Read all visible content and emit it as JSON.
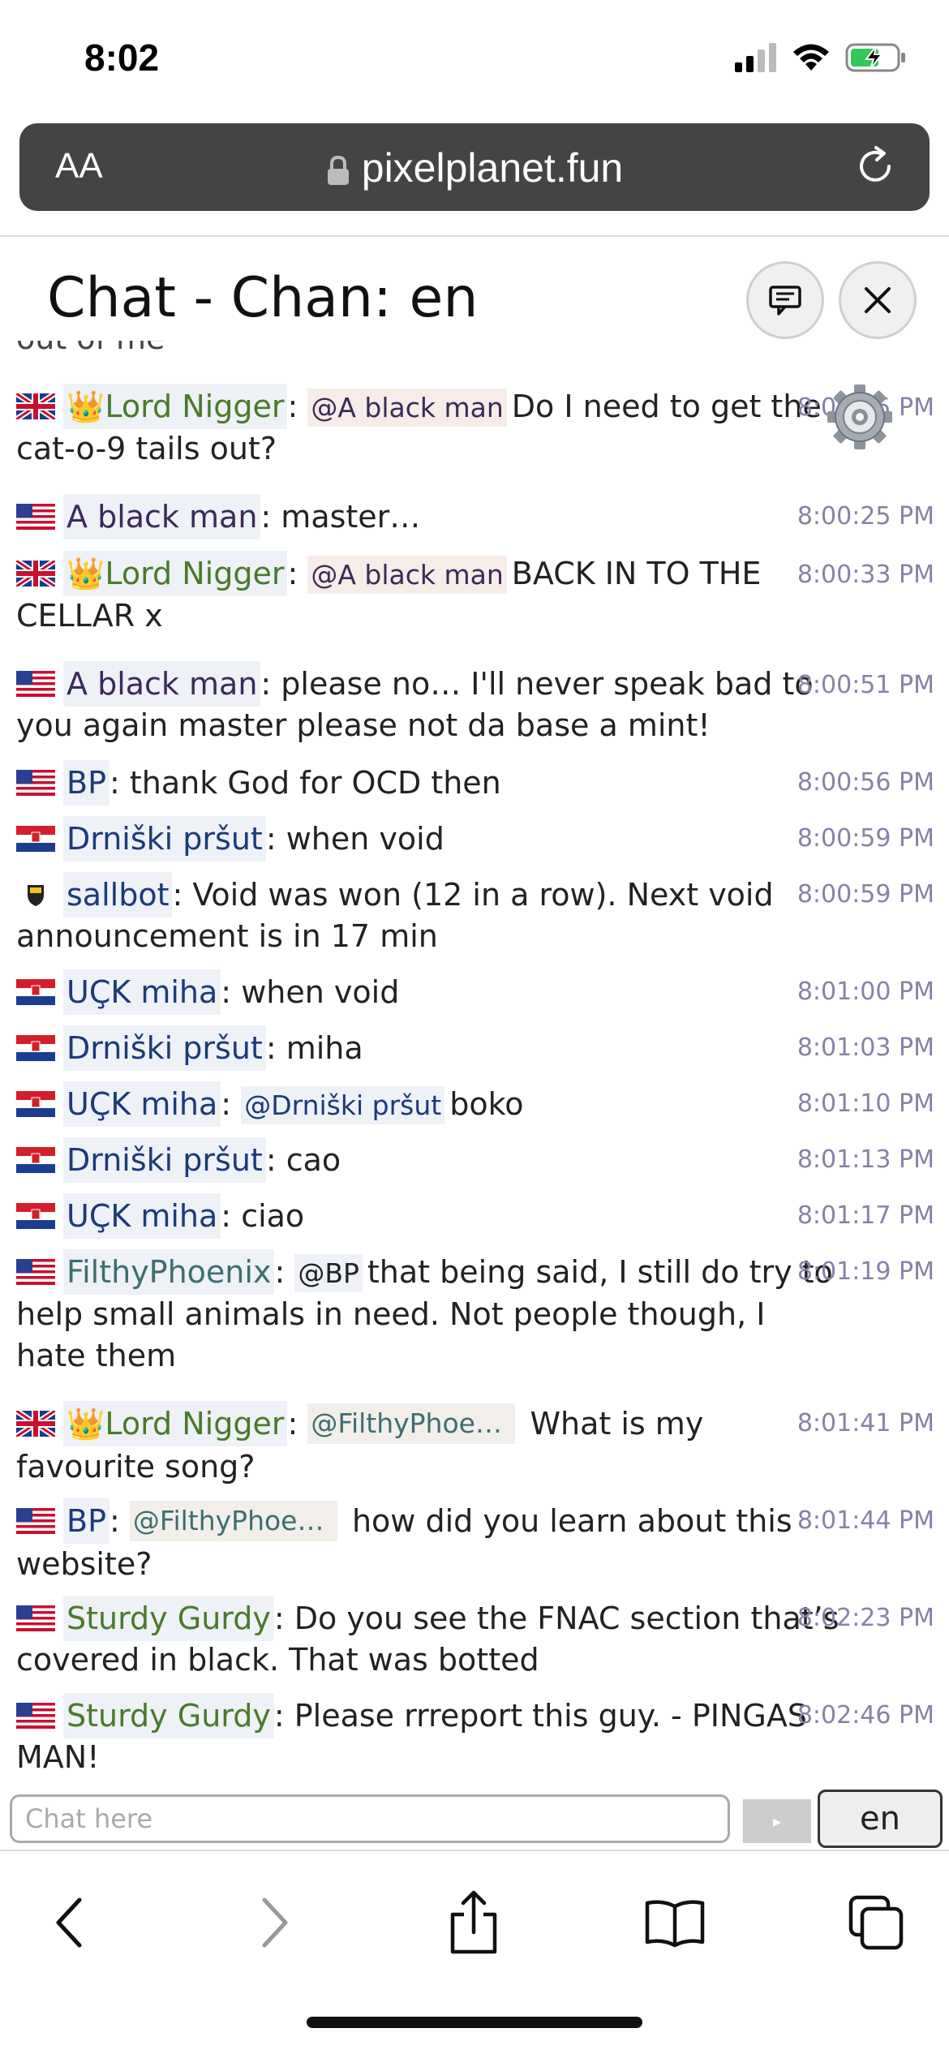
{
  "status_bar": {
    "time": "8:02"
  },
  "browser": {
    "text_size_label": "AA",
    "url": "pixelplanet.fun"
  },
  "chat": {
    "title": "Chat - Chan: en",
    "input_placeholder": "Chat here",
    "send_label": "▸",
    "channel_button_label": "en",
    "messages": [
      {
        "user": "Lord Nigger",
        "crown": "👑",
        "flag": "gb",
        "mention": "@A black man",
        "text": "Do I need to get the cat-o-9 tails out?",
        "time": "8:00:15 PM"
      },
      {
        "user": "A black man",
        "flag": "us",
        "text": "master…",
        "time": "8:00:25 PM"
      },
      {
        "user": "Lord Nigger",
        "crown": "👑",
        "flag": "gb",
        "mention": "@A black man",
        "text": "BACK IN TO THE CELLAR x",
        "time": "8:00:33 PM"
      },
      {
        "user": "A black man",
        "flag": "us",
        "text": "please no… I'll never speak bad to you again master please not da base a mint!",
        "time": "8:00:51 PM"
      },
      {
        "user": "BP",
        "flag": "us",
        "text": "thank God for OCD then",
        "time": "8:00:56 PM"
      },
      {
        "user": "Drniški pršut",
        "flag": "hr",
        "text": "when void",
        "time": "8:00:59 PM"
      },
      {
        "user": "sallbot",
        "flag": "bot",
        "text": "Void was won (12 in a row). Next void announcement is in 17 min",
        "time": "8:00:59 PM"
      },
      {
        "user": "UÇK miha",
        "flag": "hr",
        "text": "when void",
        "time": "8:01:00 PM"
      },
      {
        "user": "Drniški pršut",
        "flag": "hr",
        "text": "miha",
        "time": "8:01:03 PM"
      },
      {
        "user": "UÇK miha",
        "flag": "hr",
        "mention": "@Drniški pršut",
        "text": "boko",
        "time": "8:01:10 PM"
      },
      {
        "user": "Drniški pršut",
        "flag": "hr",
        "text": "cao",
        "time": "8:01:13 PM"
      },
      {
        "user": "UÇK miha",
        "flag": "hr",
        "text": "ciao",
        "time": "8:01:17 PM"
      },
      {
        "user": "FilthyPhoenix",
        "flag": "us",
        "mention": "@BP",
        "text": "that being said, I still do try to help small animals in need. Not people though, I hate them",
        "time": "8:01:19 PM"
      },
      {
        "user": "Lord Nigger",
        "crown": "👑",
        "flag": "gb",
        "mention": "@FilthyPhoenix",
        "text": "What is my favourite song?",
        "time": "8:01:41 PM"
      },
      {
        "user": "BP",
        "flag": "us",
        "mention": "@FilthyPhoenix",
        "text": "how did you learn about this website?",
        "time": "8:01:44 PM"
      },
      {
        "user": "Sturdy Gurdy",
        "flag": "us",
        "text": "Do you see the FNAC section that’s covered in black. That was botted",
        "time": "8:02:23 PM"
      },
      {
        "user": "Sturdy Gurdy",
        "flag": "us",
        "text": "Please rrreport this guy. - PINGAS MAN!",
        "time": "8:02:46 PM"
      }
    ]
  },
  "icons": {
    "signal": "cellular-signal-icon",
    "wifi": "wifi-icon",
    "battery": "battery-charging-icon",
    "lock": "lock-icon",
    "reload": "reload-icon",
    "gear": "gear-icon",
    "back": "chevron-left-icon",
    "forward": "chevron-right-icon",
    "share": "share-icon",
    "bookmarks": "book-icon",
    "tabs": "tabs-icon"
  },
  "colors": {
    "url_bar": "#444444",
    "name_purple": "#3c2a58",
    "name_green": "#4a7a2a",
    "name_navy": "#1c3a78",
    "name_teal": "#3d6e70",
    "timestamp": "#8a80a8",
    "battery": "#34c759"
  }
}
